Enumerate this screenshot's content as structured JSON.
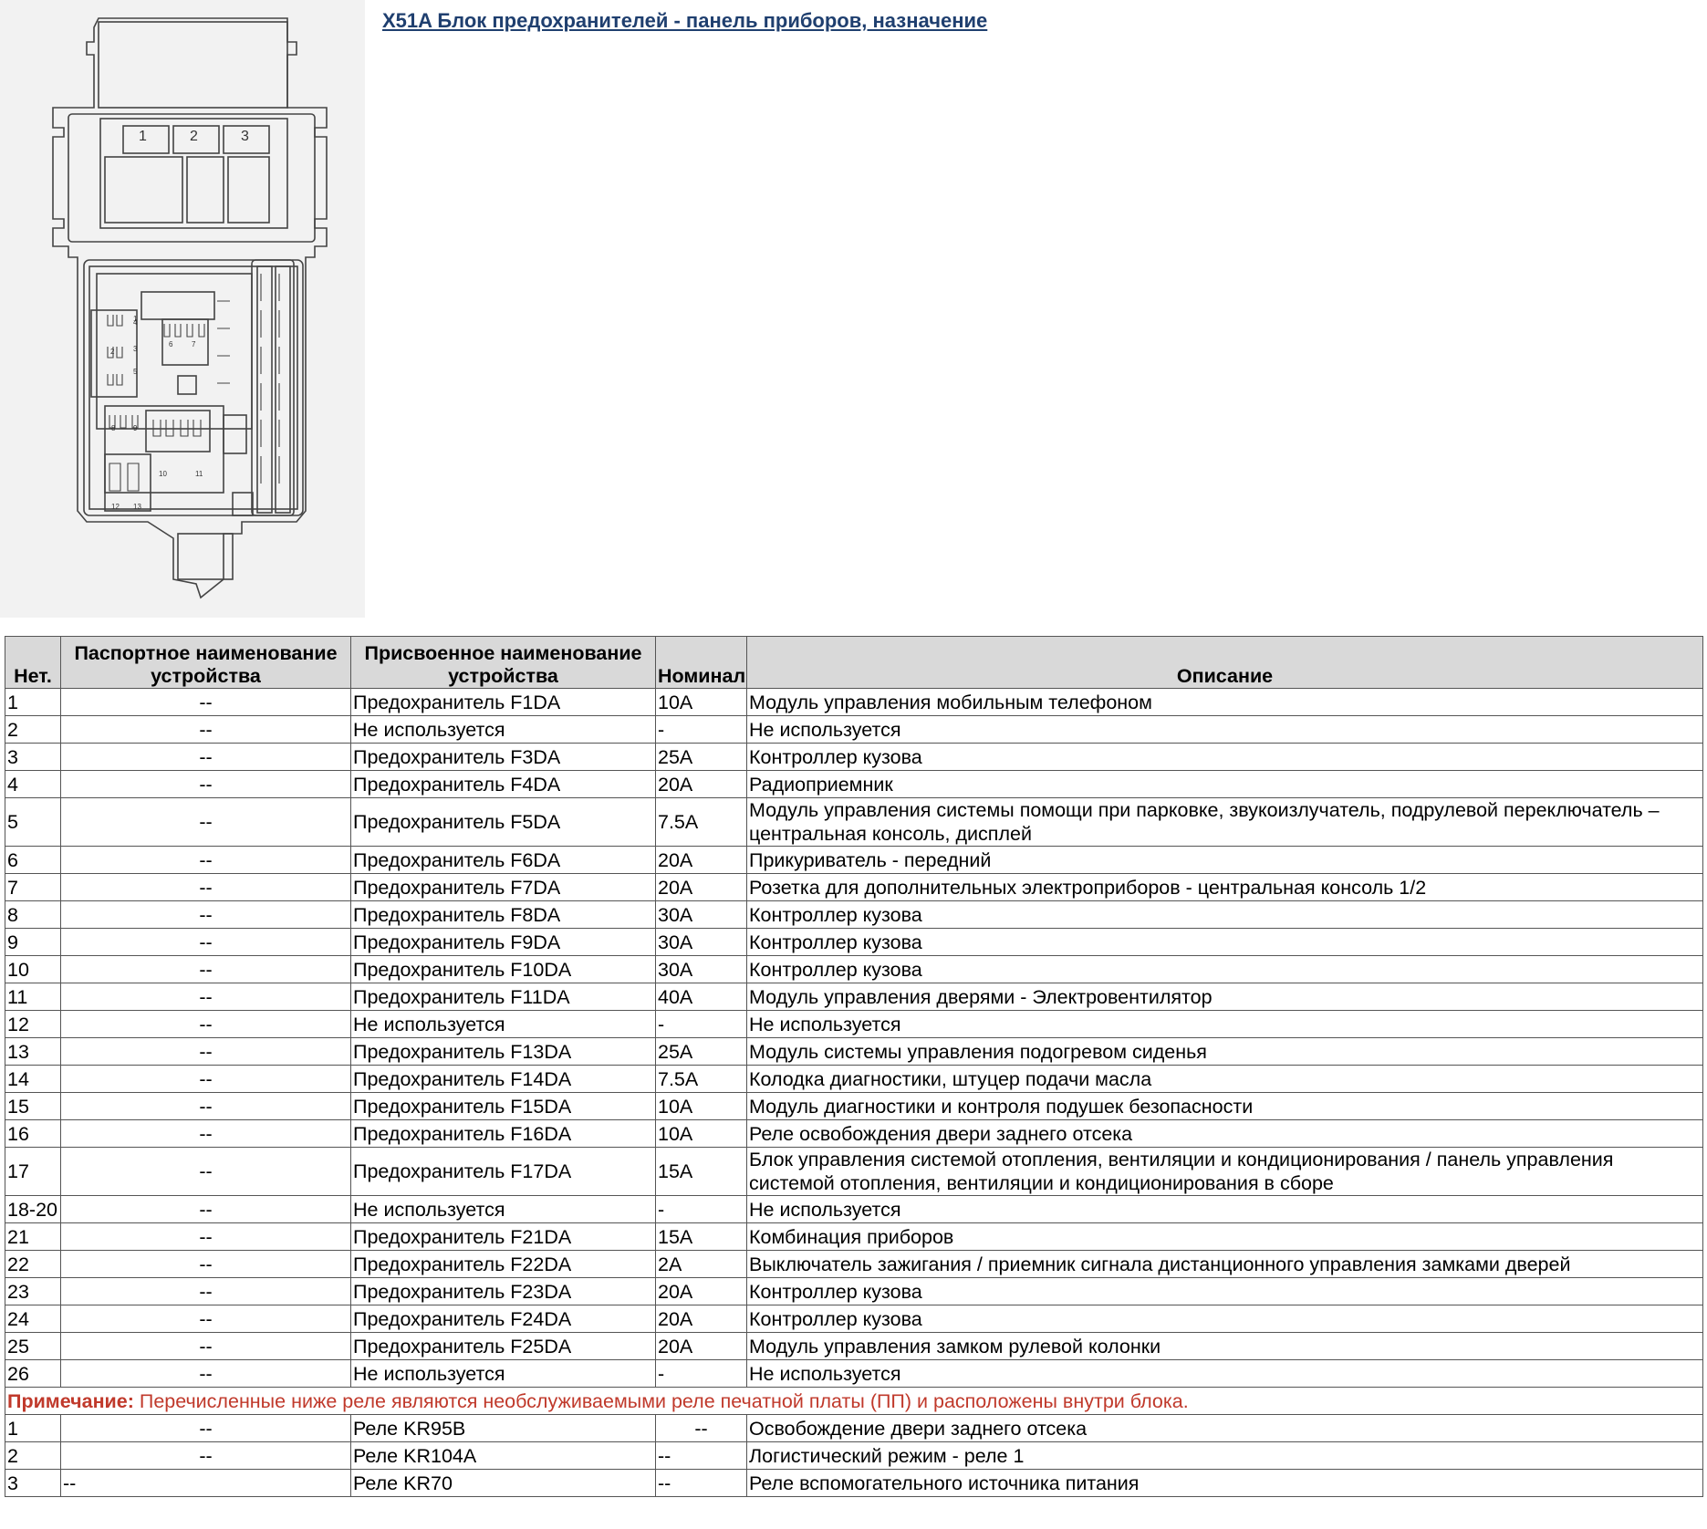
{
  "title": "X51A Блок предохранителей - панель приборов, назначение",
  "diagram": {
    "relay_labels": [
      "1",
      "2",
      "3"
    ],
    "fuse_labels_small": [
      "1",
      "2",
      "3",
      "4",
      "5",
      "6",
      "7",
      "8",
      "9",
      "10",
      "11",
      "12",
      "13"
    ]
  },
  "table": {
    "headers": {
      "num": "Нет.",
      "passport": "Паспортное наименование устройства",
      "assigned": "Присвоенное наименование устройства",
      "rating": "Номинал",
      "description": "Описание"
    },
    "rows": [
      {
        "num": "1",
        "passport": "--",
        "assigned": "Предохранитель F1DA",
        "rating": "10A",
        "description": "Модуль управления мобильным телефоном"
      },
      {
        "num": "2",
        "passport": "--",
        "assigned": "Не используется",
        "rating": "-",
        "description": "Не используется"
      },
      {
        "num": "3",
        "passport": "--",
        "assigned": "Предохранитель F3DA",
        "rating": "25A",
        "description": "Контроллер кузова"
      },
      {
        "num": "4",
        "passport": "--",
        "assigned": "Предохранитель F4DA",
        "rating": "20A",
        "description": "Радиоприемник"
      },
      {
        "num": "5",
        "passport": "--",
        "assigned": "Предохранитель F5DA",
        "rating": "7.5A",
        "description": "Модуль управления системы помощи при парковке, звукоизлучатель, подрулевой переключатель – центральная консоль, дисплей"
      },
      {
        "num": "6",
        "passport": "--",
        "assigned": "Предохранитель F6DA",
        "rating": "20A",
        "description": "Прикуриватель - передний"
      },
      {
        "num": "7",
        "passport": "--",
        "assigned": "Предохранитель F7DA",
        "rating": "20A",
        "description": "Розетка для дополнительных электроприборов - центральная консоль 1/2"
      },
      {
        "num": "8",
        "passport": "--",
        "assigned": "Предохранитель F8DA",
        "rating": "30A",
        "description": "Контроллер кузова"
      },
      {
        "num": "9",
        "passport": "--",
        "assigned": "Предохранитель F9DA",
        "rating": "30A",
        "description": "Контроллер кузова"
      },
      {
        "num": "10",
        "passport": "--",
        "assigned": "Предохранитель F10DA",
        "rating": "30A",
        "description": "Контроллер кузова"
      },
      {
        "num": "11",
        "passport": "--",
        "assigned": "Предохранитель F11DA",
        "rating": "40A",
        "description": "Модуль управления дверями - Электровентилятор"
      },
      {
        "num": "12",
        "passport": "--",
        "assigned": "Не используется",
        "rating": "-",
        "description": "Не используется"
      },
      {
        "num": "13",
        "passport": "--",
        "assigned": "Предохранитель F13DA",
        "rating": "25A",
        "description": "Модуль системы управления подогревом сиденья"
      },
      {
        "num": "14",
        "passport": "--",
        "assigned": "Предохранитель F14DA",
        "rating": "7.5A",
        "description": "Колодка диагностики, штуцер подачи масла"
      },
      {
        "num": "15",
        "passport": "--",
        "assigned": "Предохранитель F15DA",
        "rating": "10A",
        "description": "Модуль диагностики и контроля подушек безопасности"
      },
      {
        "num": "16",
        "passport": "--",
        "assigned": "Предохранитель F16DA",
        "rating": "10A",
        "description": "Реле освобождения двери заднего отсека"
      },
      {
        "num": "17",
        "passport": "--",
        "assigned": "Предохранитель F17DA",
        "rating": "15A",
        "description": "Блок управления системой отопления, вентиляции и кондиционирования / панель управления системой отопления, вентиляции и кондиционирования в сборе"
      },
      {
        "num": "18-20",
        "passport": "--",
        "assigned": "Не используется",
        "rating": "-",
        "description": "Не используется"
      },
      {
        "num": "21",
        "passport": "--",
        "assigned": "Предохранитель F21DA",
        "rating": "15A",
        "description": "Комбинация приборов"
      },
      {
        "num": "22",
        "passport": "--",
        "assigned": "Предохранитель F22DA",
        "rating": "2A",
        "description": "Выключатель зажигания / приемник сигнала дистанционного управления замками дверей"
      },
      {
        "num": "23",
        "passport": "--",
        "assigned": "Предохранитель F23DA",
        "rating": "20A",
        "description": "Контроллер кузова"
      },
      {
        "num": "24",
        "passport": "--",
        "assigned": "Предохранитель F24DA",
        "rating": "20A",
        "description": "Контроллер кузова"
      },
      {
        "num": "25",
        "passport": "--",
        "assigned": "Предохранитель F25DA",
        "rating": "20A",
        "description": "Модуль управления замком рулевой колонки"
      },
      {
        "num": "26",
        "passport": "--",
        "assigned": "Не используется",
        "rating": "-",
        "description": "Не используется"
      }
    ],
    "note": {
      "label": "Примечание:",
      "text": " Перечисленные ниже реле являются необслуживаемыми реле печатной платы (ПП) и расположены внутри блока."
    },
    "relay_rows": [
      {
        "num": "1",
        "passport": "--",
        "assigned": "Реле KR95B",
        "rating": "--",
        "description": "Освобождение двери заднего отсека"
      },
      {
        "num": "2",
        "passport": "--",
        "assigned": "Реле KR104A",
        "rating": "--",
        "description": "Логистический режим - реле 1"
      },
      {
        "num": "3",
        "passport": "--",
        "assigned": "Реле KR70",
        "rating": "--",
        "description": "Реле вспомогательного источника питания"
      }
    ]
  }
}
